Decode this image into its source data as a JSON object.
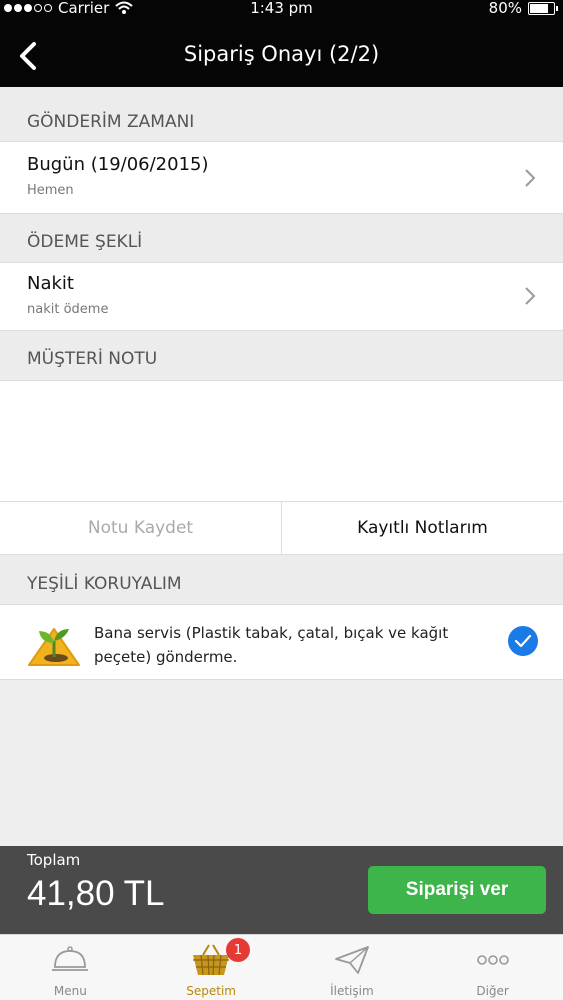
{
  "status": {
    "carrier": "Carrier",
    "time": "1:43 pm",
    "battery": "80%",
    "signal_bars_filled": 3,
    "battery_level": 0.8
  },
  "nav": {
    "title": "Sipariş Onayı (2/2)"
  },
  "delivery": {
    "header": "GÖNDERİM ZAMANI",
    "value": "Bugün (19/06/2015)",
    "sub": "Hemen"
  },
  "payment": {
    "header": "ÖDEME ŞEKLİ",
    "value": "Nakit",
    "sub": "nakit ödeme"
  },
  "note": {
    "header": "MÜŞTERİ NOTU",
    "save_label": "Notu Kaydet",
    "saved_label": "Kayıtlı Notlarım"
  },
  "green": {
    "header": "YEŞİLİ KORUYALIM",
    "text": "Bana servis (Plastik tabak, çatal, bıçak ve kağıt peçete) gönderme.",
    "checked": true
  },
  "total": {
    "label": "Toplam",
    "value": "41,80 TL",
    "order_button": "Siparişi ver"
  },
  "tabs": [
    {
      "label": "Menu",
      "icon": "cloche-icon"
    },
    {
      "label": "Sepetim",
      "icon": "basket-icon",
      "active": true
    },
    {
      "label": "İletişim",
      "icon": "paper-plane-icon"
    },
    {
      "label": "Diğer",
      "icon": "more-icon"
    }
  ],
  "cart_badge": "1",
  "colors": {
    "accent_green": "#3db54a",
    "active_tab": "#b8860b",
    "check_blue": "#1a7ae6",
    "badge_red": "#e53935"
  }
}
